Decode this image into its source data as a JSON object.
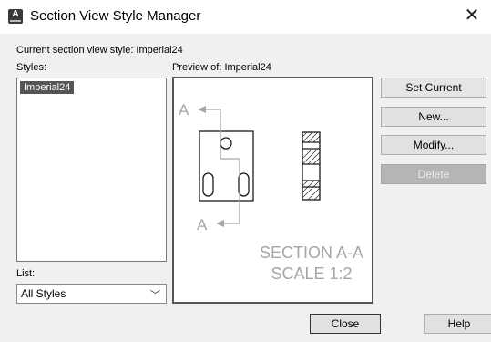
{
  "window": {
    "title": "Section View Style Manager",
    "app_icon": "autocad-icon",
    "close_glyph": "✕"
  },
  "current_style": {
    "label": "Current section view style: Imperial24"
  },
  "styles": {
    "label": "Styles:",
    "items": [
      "Imperial24"
    ],
    "selected": "Imperial24"
  },
  "list": {
    "label": "List:",
    "value": "All Styles",
    "options": [
      "All Styles"
    ]
  },
  "preview": {
    "label": "Preview of: Imperial24",
    "letter_top": "A",
    "letter_bottom": "A",
    "section_title": "SECTION A-A",
    "scale_text": "SCALE 1:2"
  },
  "buttons": {
    "set_current": "Set Current",
    "new": "New...",
    "modify": "Modify...",
    "delete": "Delete",
    "close": "Close",
    "help": "Help"
  },
  "colors": {
    "selection": "#555555",
    "preview_gray": "#a6a6a6",
    "disabled_button": "#b5b5b5"
  }
}
